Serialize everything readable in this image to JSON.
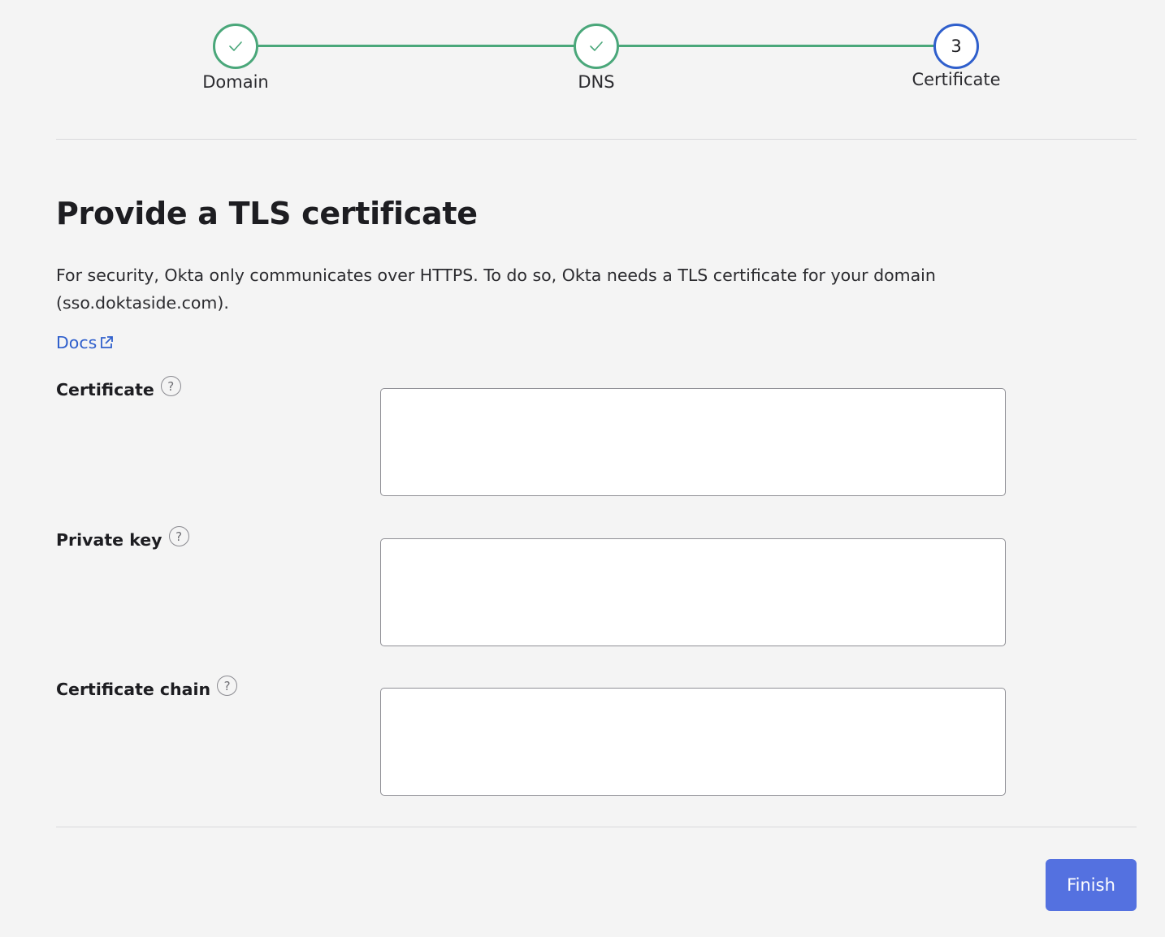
{
  "stepper": {
    "steps": [
      {
        "label": "Domain",
        "state": "complete",
        "icon": "check-icon"
      },
      {
        "label": "DNS",
        "state": "complete",
        "icon": "check-icon"
      },
      {
        "label": "Certificate",
        "state": "active",
        "number": "3"
      }
    ],
    "colors": {
      "complete": "#4aa77a",
      "active": "#2f5fcc"
    }
  },
  "main": {
    "title": "Provide a TLS certificate",
    "description": "For security, Okta only communicates over HTTPS. To do so, Okta needs a TLS certificate for your domain (sso.doktaside.com).",
    "docs_link": {
      "label": "Docs",
      "icon": "external-link-icon",
      "color": "#2f5fcc"
    }
  },
  "form": {
    "fields": [
      {
        "label": "Certificate",
        "value": "",
        "help_icon": "help-icon"
      },
      {
        "label": "Private key",
        "value": "",
        "help_icon": "help-icon"
      },
      {
        "label": "Certificate chain",
        "value": "",
        "help_icon": "help-icon"
      }
    ]
  },
  "footer": {
    "finish_label": "Finish",
    "finish_color": "#5471e0"
  }
}
